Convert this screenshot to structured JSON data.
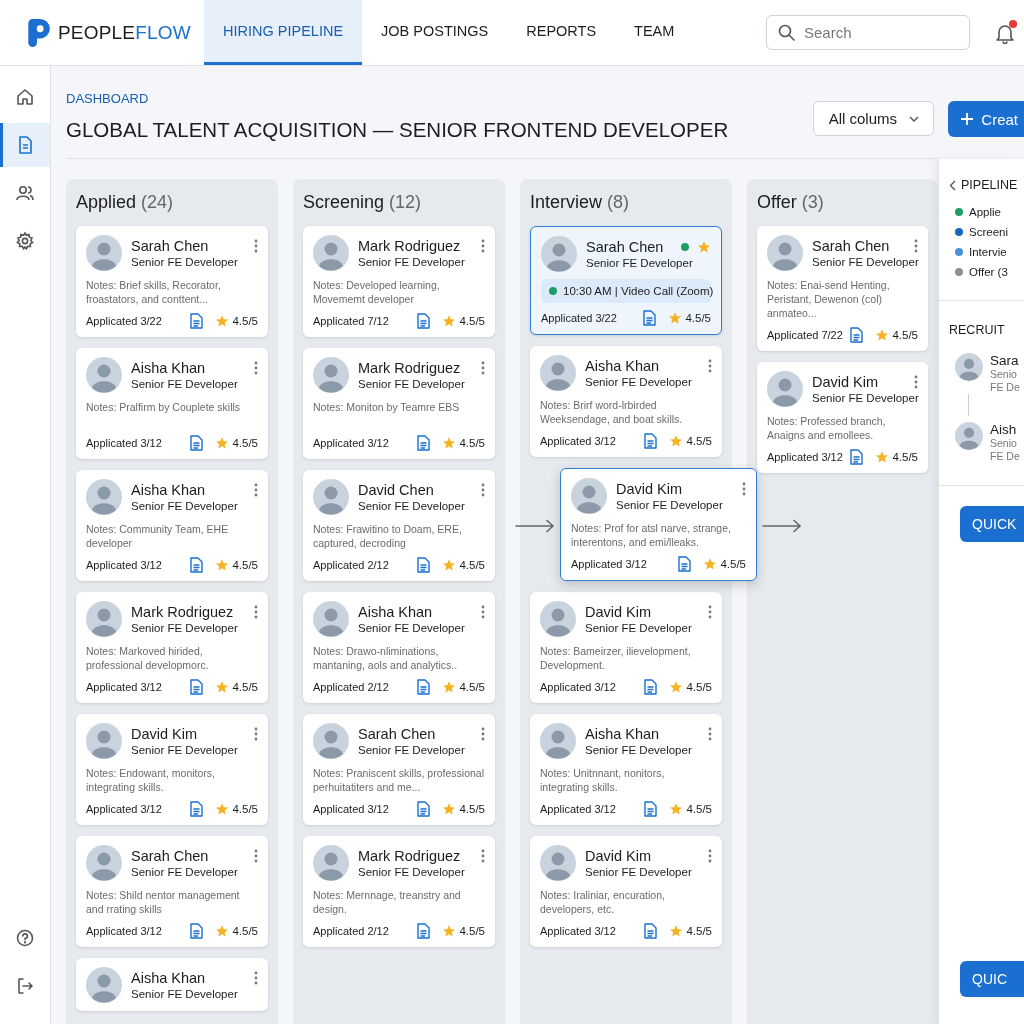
{
  "brand": {
    "name_first": "PEOPLE",
    "name_second": "FLOW"
  },
  "nav": {
    "tabs": [
      {
        "label": "HIRING PIPELINE",
        "selected": true
      },
      {
        "label": "JOB POSTINGS",
        "selected": false
      },
      {
        "label": "REPORTS",
        "selected": false
      },
      {
        "label": "TEAM",
        "selected": false
      }
    ]
  },
  "search": {
    "placeholder": "Search"
  },
  "notifications": {
    "unread": true
  },
  "sidebar": {
    "items": [
      {
        "kind": "home",
        "selected": false
      },
      {
        "kind": "document",
        "selected": true
      },
      {
        "kind": "people",
        "selected": false
      },
      {
        "kind": "settings",
        "selected": false
      }
    ],
    "bottom_items": [
      {
        "kind": "help"
      },
      {
        "kind": "logout"
      }
    ]
  },
  "page": {
    "breadcrumb": "DASHBOARD",
    "title": "GLOBAL TALENT ACQUISITION — SENIOR FRONTEND DEVELOPER",
    "filter": {
      "label": "All colums"
    },
    "primary_button": {
      "label": "Creat"
    }
  },
  "board": {
    "columns": [
      {
        "title": "Applied",
        "count": "(24)",
        "cards": [
          {
            "kind": "standard",
            "name": "Sarah Chen",
            "role": "Senior FE Developer",
            "notes": "Notes: Brief skills, Recorator, froastators, and conttent...",
            "applied": "Applicated 3/22",
            "rating": "4.5/5"
          },
          {
            "kind": "standard",
            "name": "Aisha Khan",
            "role": "Senior FE Developer",
            "notes": "Notes: Pralfirm by Couplete skills",
            "applied": "Applicated 3/12",
            "rating": "4.5/5"
          },
          {
            "kind": "standard",
            "name": "Aisha Khan",
            "role": "Senior FE Developer",
            "notes": "Notes: Community Team, EHE developer",
            "applied": "Applicated 3/12",
            "rating": "4.5/5"
          },
          {
            "kind": "standard",
            "name": "Mark Rodriguez",
            "role": "Senior FE Developer",
            "notes": "Notes: Markoved hirided, professional developmorc.",
            "applied": "Applicated 3/12",
            "rating": "4.5/5"
          },
          {
            "kind": "standard",
            "name": "David Kim",
            "role": "Senior FE Developer",
            "notes": "Notes: Endowant, monitors, integrating skills.",
            "applied": "Applicated 3/12",
            "rating": "4.5/5"
          },
          {
            "kind": "standard",
            "name": "Sarah Chen",
            "role": "Senior FE Developer",
            "notes": "Notes: Shild nentor management and rrating skills",
            "applied": "Applicated 3/12",
            "rating": "4.5/5"
          },
          {
            "kind": "partial",
            "name": "Aisha Khan",
            "role": "Senior FE Developer"
          }
        ]
      },
      {
        "title": "Screening",
        "count": "(12)",
        "cards": [
          {
            "kind": "standard",
            "name": "Mark Rodriguez",
            "role": "Senior FE Developer",
            "notes": "Notes: Developed learning, Movememt developer",
            "applied": "Applicated 7/12",
            "rating": "4.5/5"
          },
          {
            "kind": "standard",
            "name": "Mark Rodriguez",
            "role": "Senior FE Developer",
            "notes": "Notes: Moniton by Teamre EBS",
            "applied": "Applicated 3/12",
            "rating": "4.5/5"
          },
          {
            "kind": "standard",
            "name": "David Chen",
            "role": "Senior FE Developer",
            "notes": "Notes: Frawitino to Doam, ERE, captured, decroding",
            "applied": "Applicated 2/12",
            "rating": "4.5/5"
          },
          {
            "kind": "standard",
            "name": "Aisha Khan",
            "role": "Senior FE Developer",
            "notes": "Notes: Drawo-nliminations, mantaning, aols and analytics..",
            "applied": "Applicated 2/12",
            "rating": "4.5/5"
          },
          {
            "kind": "standard",
            "name": "Sarah Chen",
            "role": "Senior FE Developer",
            "notes": "Notes: Praniscent skills, professional perhuitatiters and me...",
            "applied": "Applicated 3/12",
            "rating": "4.5/5"
          },
          {
            "kind": "standard",
            "name": "Mark Rodriguez",
            "role": "Senior FE Developer",
            "notes": "Notes: Mernnage, treanstry and design.",
            "applied": "Applicated 2/12",
            "rating": "4.5/5"
          }
        ]
      },
      {
        "title": "Interview",
        "count": "(8)",
        "cards": [
          {
            "kind": "scheduled",
            "name": "Sarah Chen",
            "role": "Senior FE Developer",
            "meeting": "10:30 AM | Video Call (Zoom)",
            "applied": "Applicated 3/22",
            "rating": "4.5/5"
          },
          {
            "kind": "standard",
            "name": "Aisha Khan",
            "role": "Senior FE Developer",
            "notes": "Notes: Brirf word-lrbirded Weeksendage, and boat skills.",
            "applied": "Applicated 3/12",
            "rating": "4.5/5"
          },
          {
            "kind": "dragging",
            "name": "David Kim",
            "role": "Senior FE Developer",
            "notes": "Notes: Prof for atsl narve, strange, interentons, and emi/lleaks.",
            "applied": "Applicated 3/12",
            "rating": "4.5/5"
          },
          {
            "kind": "standard",
            "name": "David Kim",
            "role": "Senior FE Developer",
            "notes": "Notes: Bameirzer, ilievelopment, Development.",
            "applied": "Applicated 3/12",
            "rating": "4.5/5"
          },
          {
            "kind": "standard",
            "name": "Aisha Khan",
            "role": "Senior FE Developer",
            "notes": "Notes: Unitnnant, nonitors, integrating skills.",
            "applied": "Applicated 3/12",
            "rating": "4.5/5"
          },
          {
            "kind": "standard",
            "name": "David Kim",
            "role": "Senior FE Developer",
            "notes": "Notes: Iraliniar, encuration, developers, etc.",
            "applied": "Applicated 3/12",
            "rating": "4.5/5"
          }
        ]
      },
      {
        "title": "Offer",
        "count": "(3)",
        "cards": [
          {
            "kind": "standard",
            "name": "Sarah Chen",
            "role": "Senior FE Developer",
            "notes": "Notes: Enai-send Henting, Peristant, Dewenon (col) anmateo...",
            "applied": "Applicated 7/22",
            "rating": "4.5/5"
          },
          {
            "kind": "standard",
            "name": "David Kim",
            "role": "Senior FE Developer",
            "notes": "Notes: Professed branch, Anaigns and emollees.",
            "applied": "Applicated 3/12",
            "rating": "4.5/5"
          }
        ]
      }
    ]
  },
  "pipeline_panel": {
    "title": "PIPELINE",
    "stages": [
      {
        "label": "Applie",
        "color": "#1f9d63"
      },
      {
        "label": "Screeni",
        "color": "#1565c0"
      },
      {
        "label": "Intervie",
        "color": "#4a8fd8"
      },
      {
        "label": "Offer (3",
        "color": "#8a8f98"
      }
    ],
    "recruiters_title": "RECRUIT",
    "recruiters": [
      {
        "name": "Sara",
        "role_lines": [
          "Senio",
          "FE De"
        ]
      },
      {
        "name": "Aish",
        "role_lines": [
          "Senio",
          "FE De"
        ]
      }
    ],
    "quick_button": "QUICK",
    "footer_button": "QUIC"
  }
}
